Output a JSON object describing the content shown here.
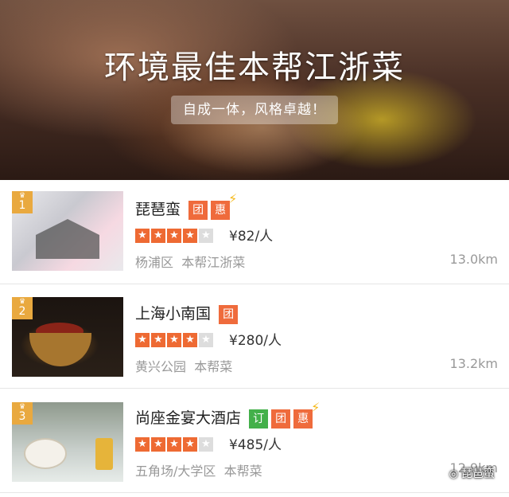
{
  "hero": {
    "title": "环境最佳本帮江浙菜",
    "subtitle": "自成一体，风格卓越！"
  },
  "restaurants": [
    {
      "rank": "1",
      "name": "琵琶蛮",
      "tags": [
        "团",
        "惠"
      ],
      "tag_colors": [
        "#ef6b3c",
        "#ef6b3c"
      ],
      "lightning": true,
      "rating": 4,
      "price": "¥82/人",
      "area": "杨浦区",
      "cuisine": "本帮江浙菜",
      "distance": "13.0km"
    },
    {
      "rank": "2",
      "name": "上海小南国",
      "tags": [
        "团"
      ],
      "tag_colors": [
        "#ef6b3c"
      ],
      "lightning": false,
      "rating": 4,
      "price": "¥280/人",
      "area": "黄兴公园",
      "cuisine": "本帮菜",
      "distance": "13.2km"
    },
    {
      "rank": "3",
      "name": "尚座金宴大酒店",
      "tags": [
        "订",
        "团",
        "惠"
      ],
      "tag_colors": [
        "#43b04a",
        "#ef6b3c",
        "#ef6b3c"
      ],
      "lightning": true,
      "rating": 4,
      "price": "¥485/人",
      "area": "五角场/大学区",
      "cuisine": "本帮菜",
      "distance": "12.9km"
    }
  ],
  "watermark": {
    "text": "琵琶蛮",
    "icon": "wechat-icon"
  },
  "colors": {
    "accent": "#ef6b3c",
    "rank_badge": "#e9a93f",
    "green_tag": "#43b04a",
    "bolt": "#f5b91b"
  }
}
